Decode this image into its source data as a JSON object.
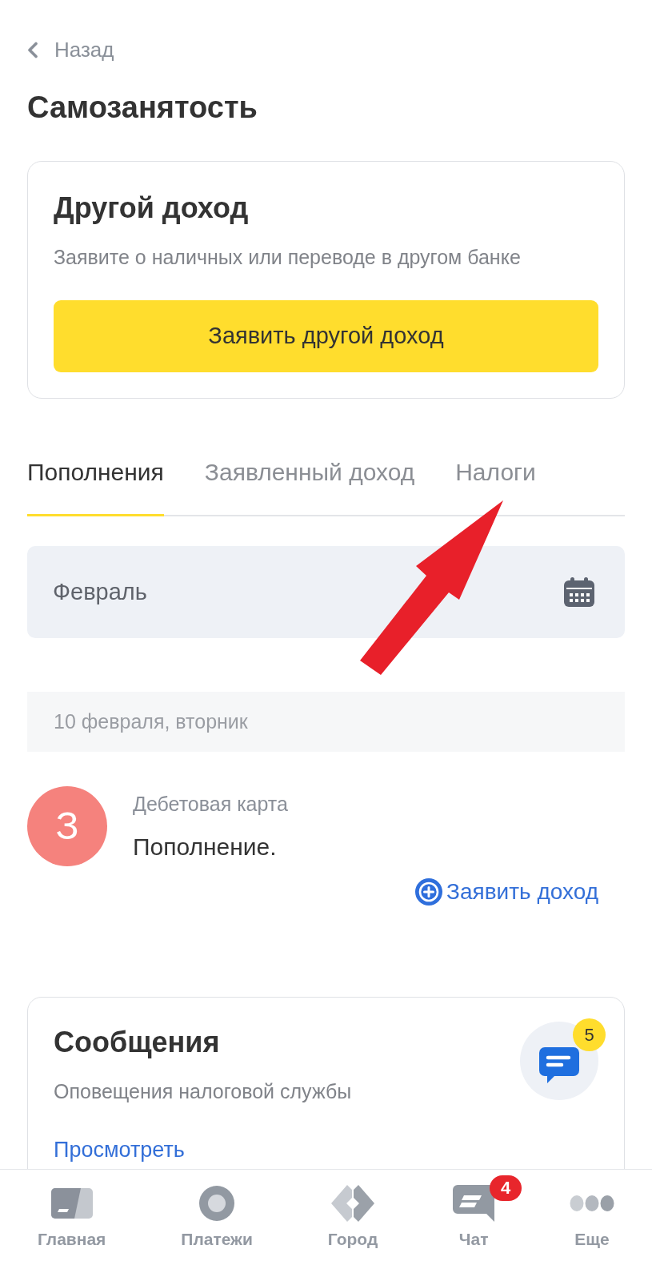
{
  "header": {
    "back_label": "Назад",
    "title": "Самозанятость"
  },
  "other_income_card": {
    "title": "Другой доход",
    "description": "Заявите о наличных или переводе в другом банке",
    "button": "Заявить другой доход"
  },
  "tabs": [
    {
      "label": "Пополнения",
      "selected": true
    },
    {
      "label": "Заявленный доход",
      "selected": false
    },
    {
      "label": "Налоги",
      "selected": false
    }
  ],
  "month_field": {
    "value": "Февраль"
  },
  "day_groups": [
    {
      "date": "10 февраля, вторник",
      "transactions": [
        {
          "initial": "З",
          "color": "#f5827d",
          "account": "Дебетовая карта",
          "description": "Пополнение.",
          "action": "Заявить доход"
        }
      ]
    }
  ],
  "messages_card": {
    "title": "Сообщения",
    "description": "Оповещения налоговой службы",
    "link": "Просмотреть",
    "badge": "5"
  },
  "bottom_nav": [
    {
      "label": "Главная",
      "kind": "home"
    },
    {
      "label": "Платежи",
      "kind": "payments"
    },
    {
      "label": "Город",
      "kind": "city"
    },
    {
      "label": "Чат",
      "kind": "chat",
      "badge": "4"
    },
    {
      "label": "Еще",
      "kind": "more"
    }
  ],
  "annotation": {
    "kind": "arrow"
  }
}
